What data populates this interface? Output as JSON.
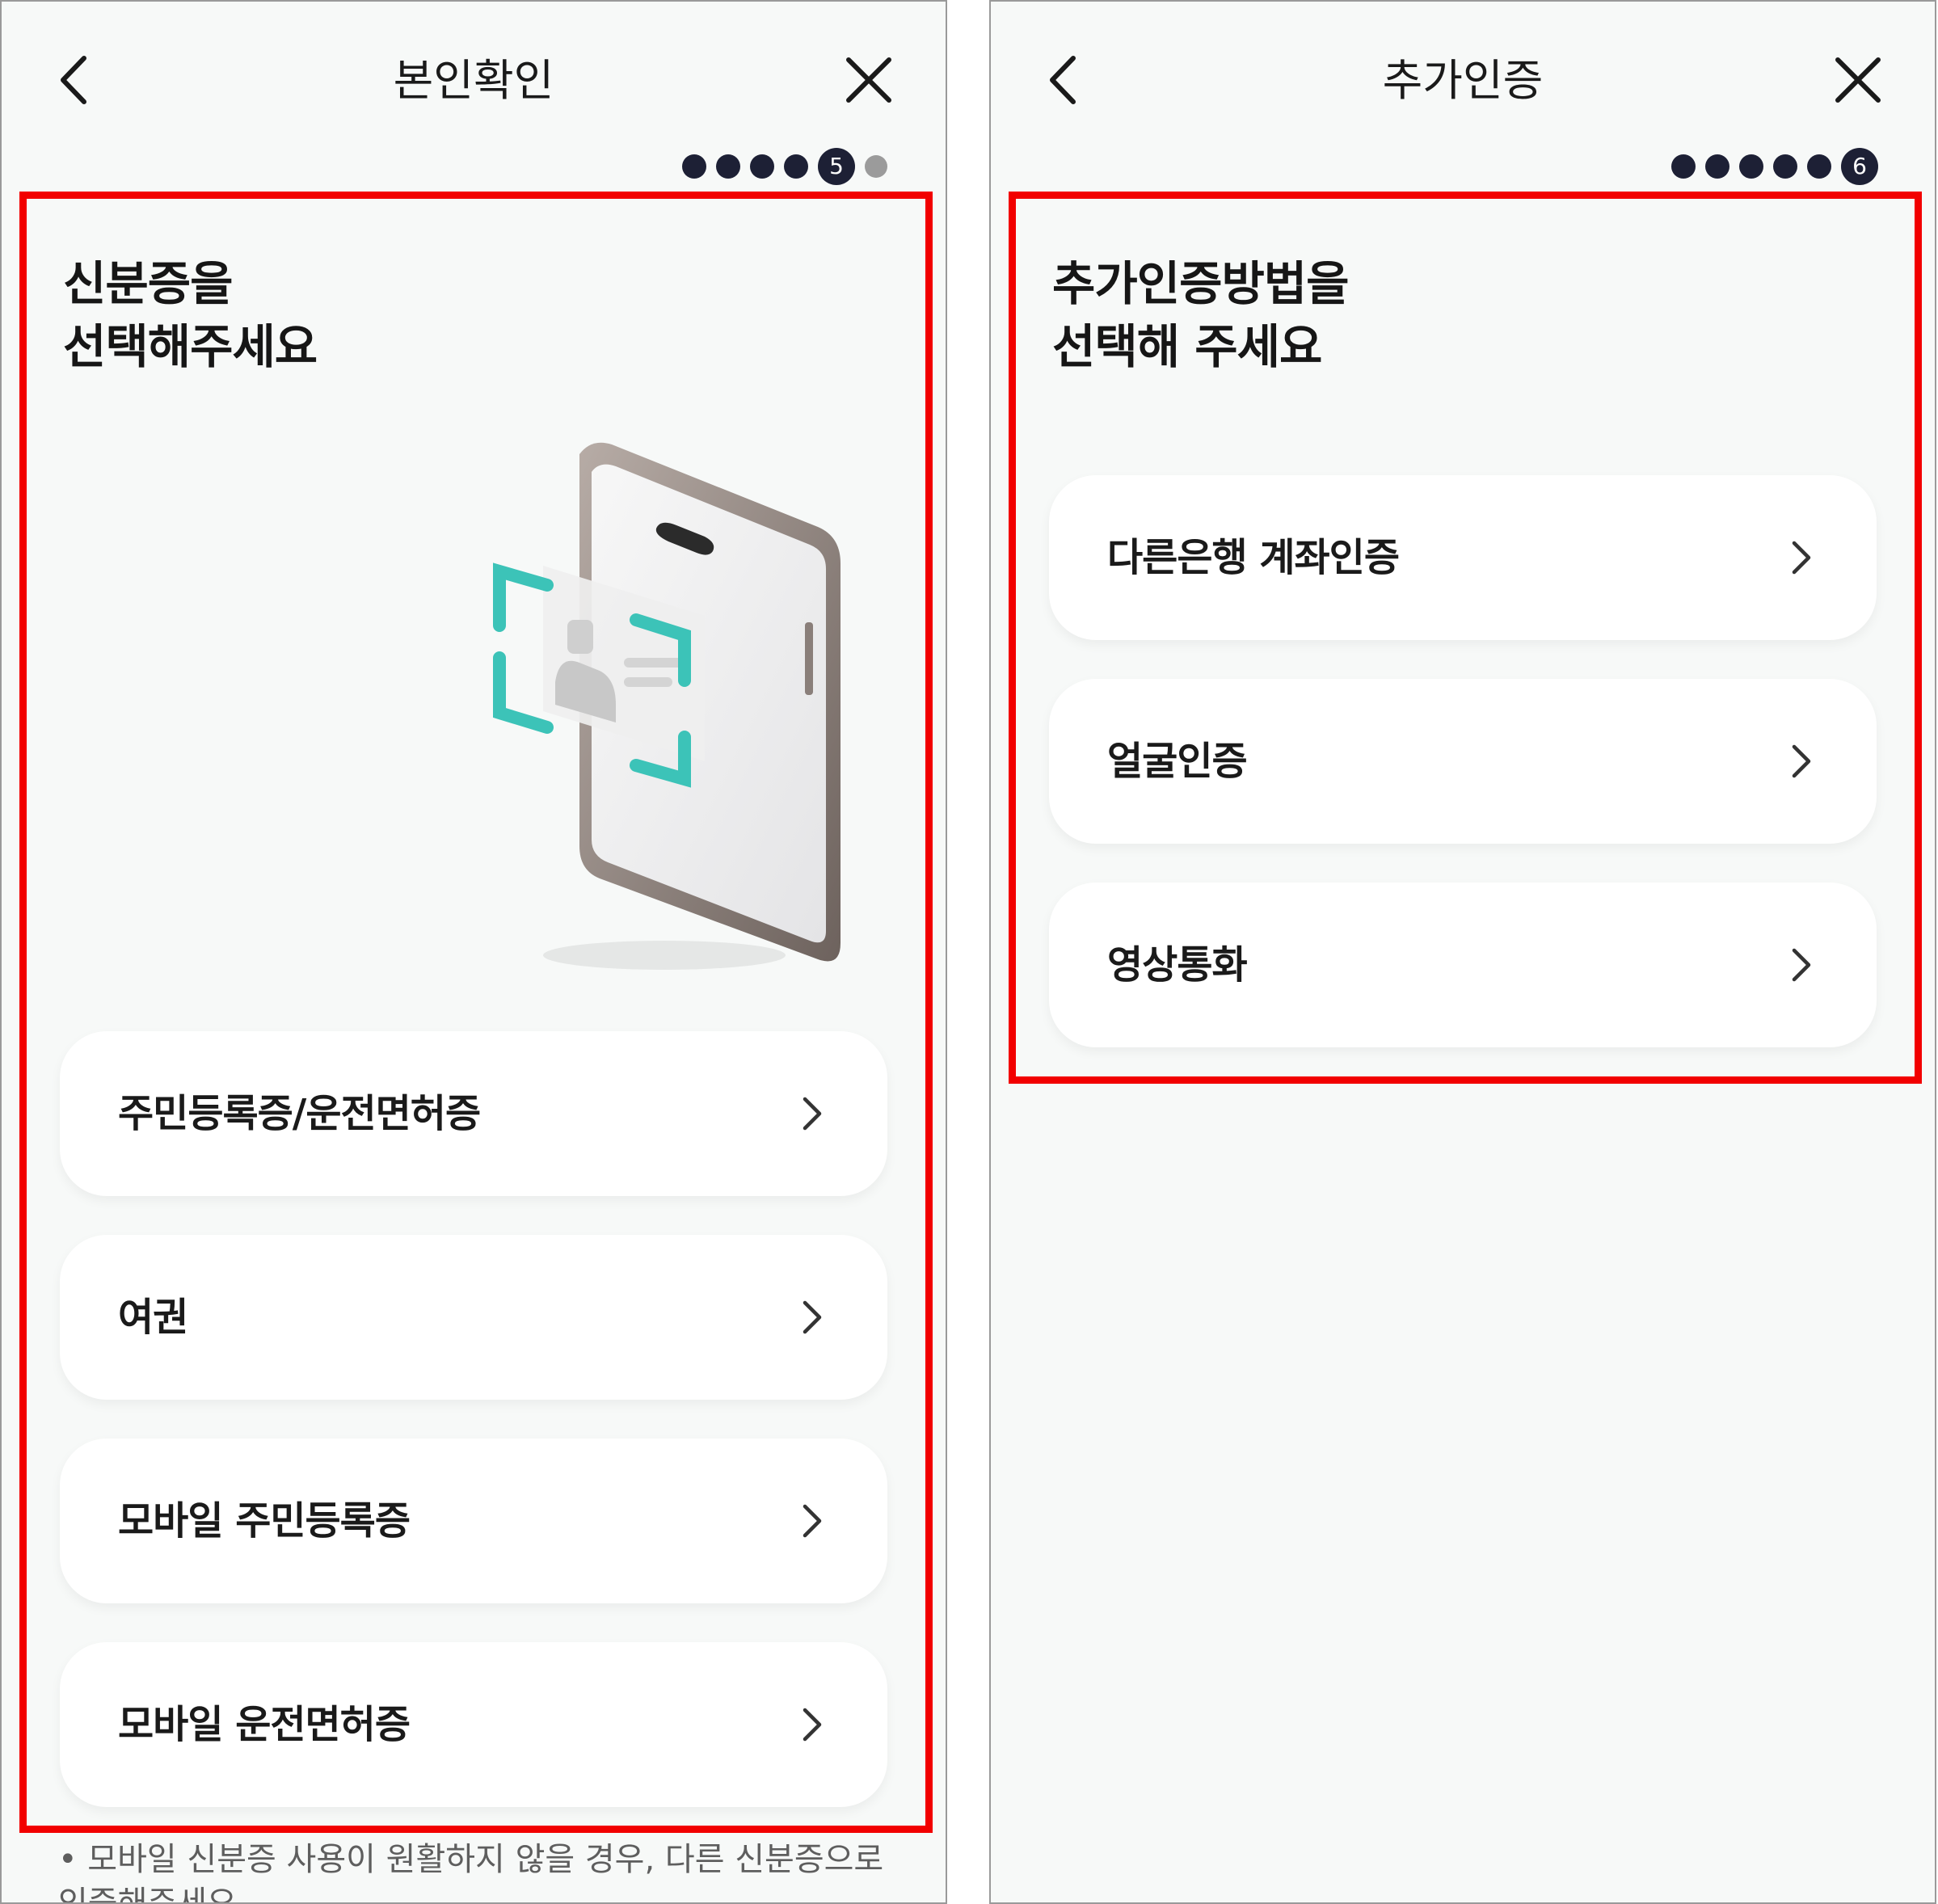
{
  "left": {
    "title": "본인확인",
    "step": "5",
    "heading_line1": "신분증을",
    "heading_line2": "선택해주세요",
    "options": [
      {
        "label": "주민등록증/운전면허증"
      },
      {
        "label": "여권"
      },
      {
        "label": "모바일 주민등록증"
      },
      {
        "label": "모바일 운전면허증"
      }
    ],
    "note": "• 모바일 신분증 사용이 원활하지 않을 경우, 다른 신분증으로 인증해주세요"
  },
  "right": {
    "title": "추가인증",
    "step": "6",
    "heading_line1": "추가인증방법을",
    "heading_line2": "선택해 주세요",
    "options": [
      {
        "label": "다른은행 계좌인증"
      },
      {
        "label": "얼굴인증"
      },
      {
        "label": "영상통화"
      }
    ]
  },
  "colors": {
    "highlight": "#f20000",
    "step_active": "#1d2035",
    "step_upcoming": "#9b9b9b",
    "accent_teal": "#3cc3b8"
  },
  "icons": [
    "back-arrow-icon",
    "close-icon",
    "chevron-right-icon",
    "id-scan-phone-illustration"
  ]
}
